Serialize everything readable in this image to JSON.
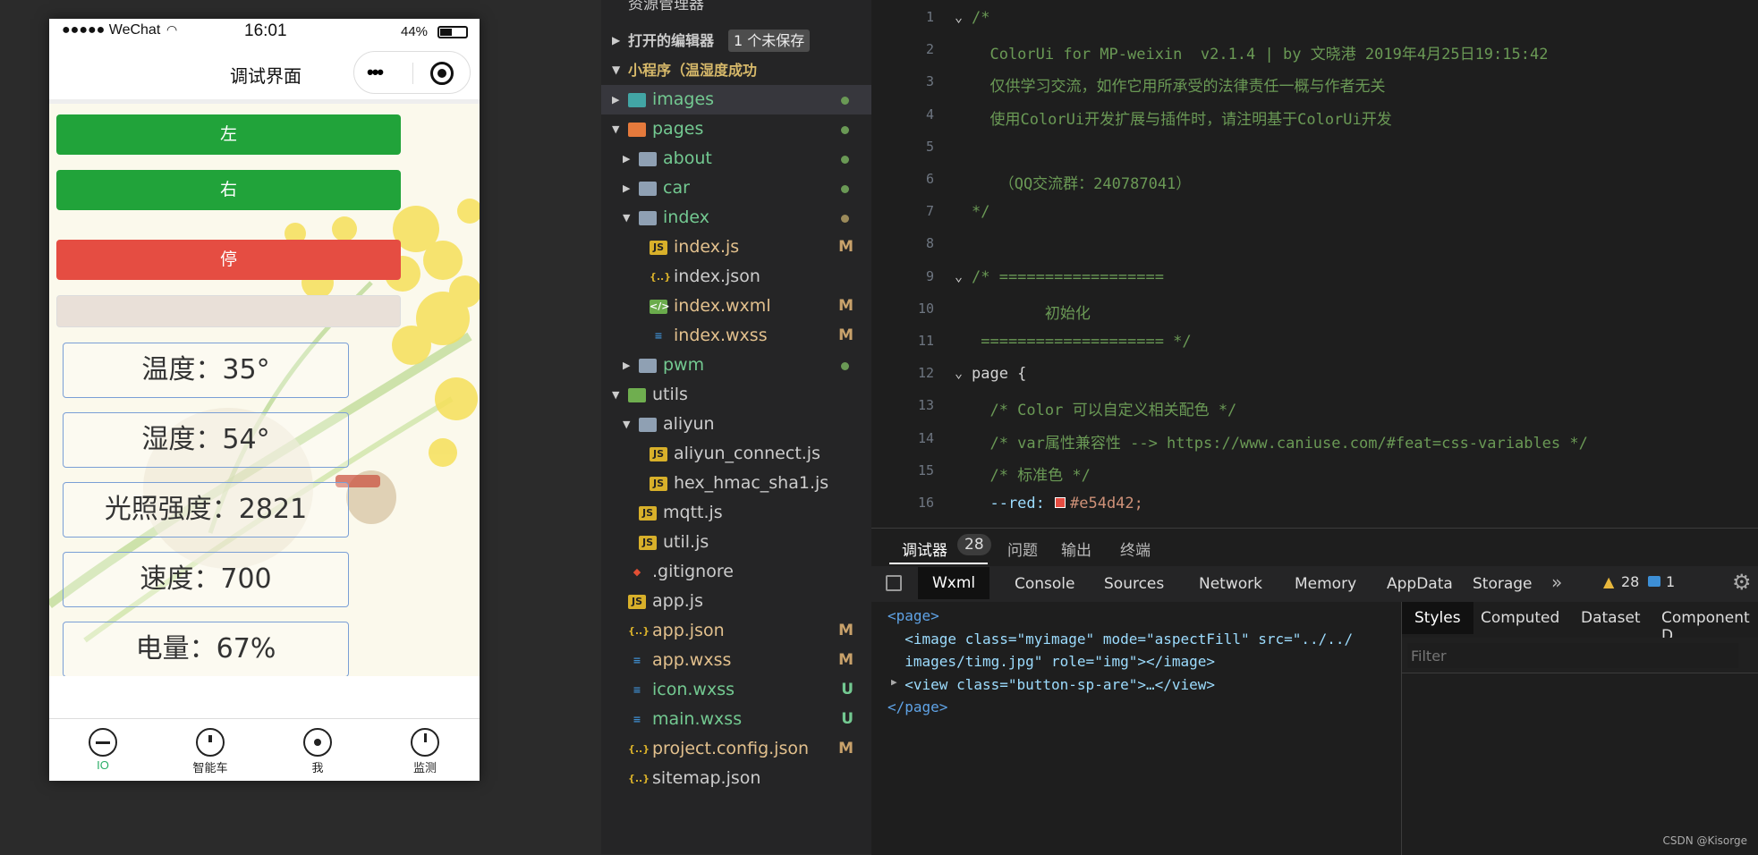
{
  "phone": {
    "status": {
      "signal": "●●●●● WeChat",
      "time": "16:01",
      "battery": "44%"
    },
    "nav_title": "调试界面",
    "buttons": {
      "left": "左",
      "right": "右",
      "stop": "停"
    },
    "cards": {
      "temp": "温度：35°",
      "humidity": "湿度：54°",
      "light": "光照强度：2821",
      "speed": "速度：700",
      "power": "电量：67%"
    },
    "tabs": [
      "IO",
      "智能车",
      "我",
      "监测"
    ]
  },
  "explorer": {
    "header": "资源管理器",
    "open_editors": "打开的编辑器",
    "unsaved_badge": "1 个未保存",
    "project": "小程序（温湿度成功",
    "items": [
      {
        "name": "images",
        "mark": "dot"
      },
      {
        "name": "pages",
        "mark": "dot"
      },
      {
        "name": "about",
        "mark": "dot"
      },
      {
        "name": "car",
        "mark": "dot"
      },
      {
        "name": "index",
        "mark": "dot"
      },
      {
        "name": "index.js",
        "mark": "M"
      },
      {
        "name": "index.json",
        "mark": ""
      },
      {
        "name": "index.wxml",
        "mark": "M"
      },
      {
        "name": "index.wxss",
        "mark": "M"
      },
      {
        "name": "pwm",
        "mark": "dot"
      },
      {
        "name": "utils",
        "mark": ""
      },
      {
        "name": "aliyun",
        "mark": ""
      },
      {
        "name": "aliyun_connect.js",
        "mark": ""
      },
      {
        "name": "hex_hmac_sha1.js",
        "mark": ""
      },
      {
        "name": "mqtt.js",
        "mark": ""
      },
      {
        "name": "util.js",
        "mark": ""
      },
      {
        "name": ".gitignore",
        "mark": ""
      },
      {
        "name": "app.js",
        "mark": ""
      },
      {
        "name": "app.json",
        "mark": "M"
      },
      {
        "name": "app.wxss",
        "mark": "M"
      },
      {
        "name": "icon.wxss",
        "mark": "U"
      },
      {
        "name": "main.wxss",
        "mark": "U"
      },
      {
        "name": "project.config.json",
        "mark": "M"
      },
      {
        "name": "sitemap.json",
        "mark": ""
      }
    ]
  },
  "editor": {
    "line_numbers": [
      "1",
      "2",
      "3",
      "4",
      "5",
      "6",
      "7",
      "8",
      "9",
      "10",
      "11",
      "12",
      "13",
      "14",
      "15",
      "16"
    ],
    "lines": [
      "/*",
      "  ColorUi for MP-weixin  v2.1.4 | by 文晓港 2019年4月25日19:15:42",
      "  仅供学习交流，如作它用所承受的法律责任一概与作者无关",
      "  使用ColorUi开发扩展与插件时，请注明基于ColorUi开发",
      "",
      "   （QQ交流群：240787041）",
      "*/",
      "",
      "/* ==================",
      "        初始化",
      " ==================== */",
      "page {",
      "  /* Color 可以自定义相关配色 */",
      "  /* var属性兼容性 --> https://www.caniuse.com/#feat=css-variables */",
      "  /* 标准色 */",
      "  --red: "
    ],
    "red_value": "#e54d42;"
  },
  "devtools": {
    "top_tabs": [
      "调试器",
      "问题",
      "输出",
      "终端"
    ],
    "debugger_badge": "28",
    "panel_tabs": [
      "Wxml",
      "Console",
      "Sources",
      "Network",
      "Memory",
      "AppData",
      "Storage"
    ],
    "warnings": "28",
    "infos": "1",
    "wxml": [
      "<page>",
      "  <image class=\"myimage\" mode=\"aspectFill\" src=\"../../",
      "  images/timg.jpg\" role=\"img\"></image>",
      "  <view class=\"button-sp-are\">…</view>",
      "</page>"
    ],
    "style_tabs": [
      "Styles",
      "Computed",
      "Dataset",
      "Component D"
    ],
    "filter_placeholder": "Filter"
  },
  "watermark": "CSDN @Kisorge"
}
